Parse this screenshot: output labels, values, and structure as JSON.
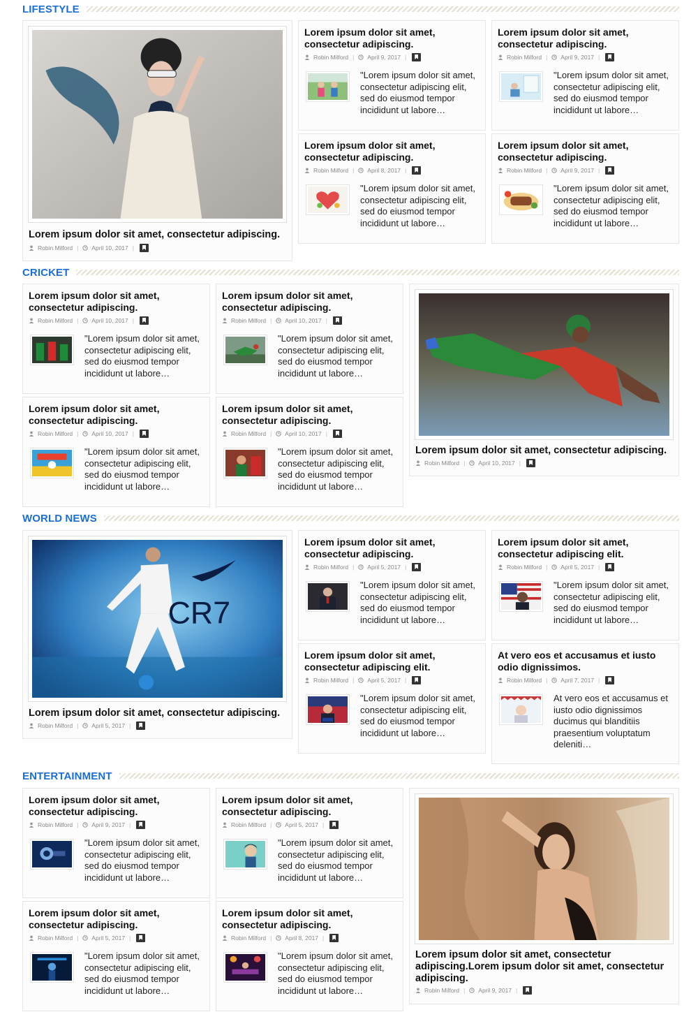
{
  "sections": [
    {
      "title": "LIFESTYLE",
      "featured": {
        "title": "Lorem ipsum dolor sit amet, consectetur adipiscing.",
        "author": "Robin Milford",
        "date": "April 10, 2017"
      },
      "posts": [
        {
          "title": "Lorem ipsum dolor sit amet, consectetur adipiscing.",
          "author": "Robin Milford",
          "date": "April 9, 2017",
          "excerpt": "\"Lorem ipsum dolor sit amet, consectetur adipiscing elit, sed do eiusmod tempor incididunt ut labore…"
        },
        {
          "title": "Lorem ipsum dolor sit amet, consectetur adipiscing.",
          "author": "Robin Milford",
          "date": "April 9, 2017",
          "excerpt": "\"Lorem ipsum dolor sit amet, consectetur adipiscing elit, sed do eiusmod tempor incididunt ut labore…"
        },
        {
          "title": "Lorem ipsum dolor sit amet, consectetur adipiscing.",
          "author": "Robin Milford",
          "date": "April 8, 2017",
          "excerpt": "\"Lorem ipsum dolor sit amet, consectetur adipiscing elit, sed do eiusmod tempor incididunt ut labore…"
        },
        {
          "title": "Lorem ipsum dolor sit amet, consectetur adipiscing.",
          "author": "Robin Milford",
          "date": "April 9, 2017",
          "excerpt": "\"Lorem ipsum dolor sit amet, consectetur adipiscing elit, sed do eiusmod tempor incididunt ut labore…"
        }
      ]
    },
    {
      "title": "CRICKET",
      "featured": {
        "title": "Lorem ipsum dolor sit amet, consectetur adipiscing.",
        "author": "Robin Milford",
        "date": "April 10, 2017"
      },
      "posts": [
        {
          "title": "Lorem ipsum dolor sit amet, consectetur adipiscing.",
          "author": "Robin Milford",
          "date": "April 10, 2017",
          "excerpt": "\"Lorem ipsum dolor sit amet, consectetur adipiscing elit, sed do eiusmod tempor incididunt ut labore…"
        },
        {
          "title": "Lorem ipsum dolor sit amet, consectetur adipiscing.",
          "author": "Robin Milford",
          "date": "April 10, 2017",
          "excerpt": "\"Lorem ipsum dolor sit amet, consectetur adipiscing elit, sed do eiusmod tempor incididunt ut labore…"
        },
        {
          "title": "Lorem ipsum dolor sit amet, consectetur adipiscing.",
          "author": "Robin Milford",
          "date": "April 10, 2017",
          "excerpt": "\"Lorem ipsum dolor sit amet, consectetur adipiscing elit, sed do eiusmod tempor incididunt ut labore…"
        },
        {
          "title": "Lorem ipsum dolor sit amet, consectetur adipiscing.",
          "author": "Robin Milford",
          "date": "April 10, 2017",
          "excerpt": "\"Lorem ipsum dolor sit amet, consectetur adipiscing elit, sed do eiusmod tempor incididunt ut labore…"
        }
      ]
    },
    {
      "title": "WORLD NEWS",
      "featured": {
        "title": "Lorem ipsum dolor sit amet, consectetur adipiscing.",
        "author": "Robin Milford",
        "date": "April 5, 2017",
        "image_text": "CR7"
      },
      "posts": [
        {
          "title": "Lorem ipsum dolor sit amet, consectetur adipiscing.",
          "author": "Robin Milford",
          "date": "April 5, 2017",
          "excerpt": "\"Lorem ipsum dolor sit amet, consectetur adipiscing elit, sed do eiusmod tempor incididunt ut labore…"
        },
        {
          "title": "Lorem ipsum dolor sit amet, consectetur adipiscing elit.",
          "author": "Robin Milford",
          "date": "April 5, 2017",
          "excerpt": "\"Lorem ipsum dolor sit amet, consectetur adipiscing elit, sed do eiusmod tempor incididunt ut labore…"
        },
        {
          "title": "Lorem ipsum dolor sit amet, consectetur adipiscing elit.",
          "author": "Robin Milford",
          "date": "April 5, 2017",
          "excerpt": "\"Lorem ipsum dolor sit amet, consectetur adipiscing elit, sed do eiusmod tempor incididunt ut labore…"
        },
        {
          "title": "At vero eos et accusamus et iusto odio dignissimos.",
          "author": "Robin Milford",
          "date": "April 7, 2017",
          "excerpt": "At vero eos et accusamus et iusto odio dignissimos ducimus qui blanditiis praesentium voluptatum deleniti…"
        }
      ]
    },
    {
      "title": "ENTERTAINMENT",
      "featured": {
        "title": "Lorem ipsum dolor sit amet, consectetur adipiscing.Lorem ipsum dolor sit amet, consectetur adipiscing.",
        "author": "Robin Milford",
        "date": "April 9, 2017"
      },
      "posts": [
        {
          "title": "Lorem ipsum dolor sit amet, consectetur adipiscing.",
          "author": "Robin Milford",
          "date": "April 9, 2017",
          "excerpt": "\"Lorem ipsum dolor sit amet, consectetur adipiscing elit, sed do eiusmod tempor incididunt ut labore…"
        },
        {
          "title": "Lorem ipsum dolor sit amet, consectetur adipiscing.",
          "author": "Robin Milford",
          "date": "April 5, 2017",
          "excerpt": "\"Lorem ipsum dolor sit amet, consectetur adipiscing elit, sed do eiusmod tempor incididunt ut labore…"
        },
        {
          "title": "Lorem ipsum dolor sit amet, consectetur adipiscing.",
          "author": "Robin Milford",
          "date": "April 5, 2017",
          "excerpt": "\"Lorem ipsum dolor sit amet, consectetur adipiscing elit, sed do eiusmod tempor incididunt ut labore…"
        },
        {
          "title": "Lorem ipsum dolor sit amet, consectetur adipiscing.",
          "author": "Robin Milford",
          "date": "April 8, 2017",
          "excerpt": "\"Lorem ipsum dolor sit amet, consectetur adipiscing elit, sed do eiusmod tempor incididunt ut labore…"
        }
      ]
    }
  ],
  "theme": {
    "accent": "#1a6fd6",
    "meta_text": "#888888",
    "card_border": "#e6e6e6"
  }
}
